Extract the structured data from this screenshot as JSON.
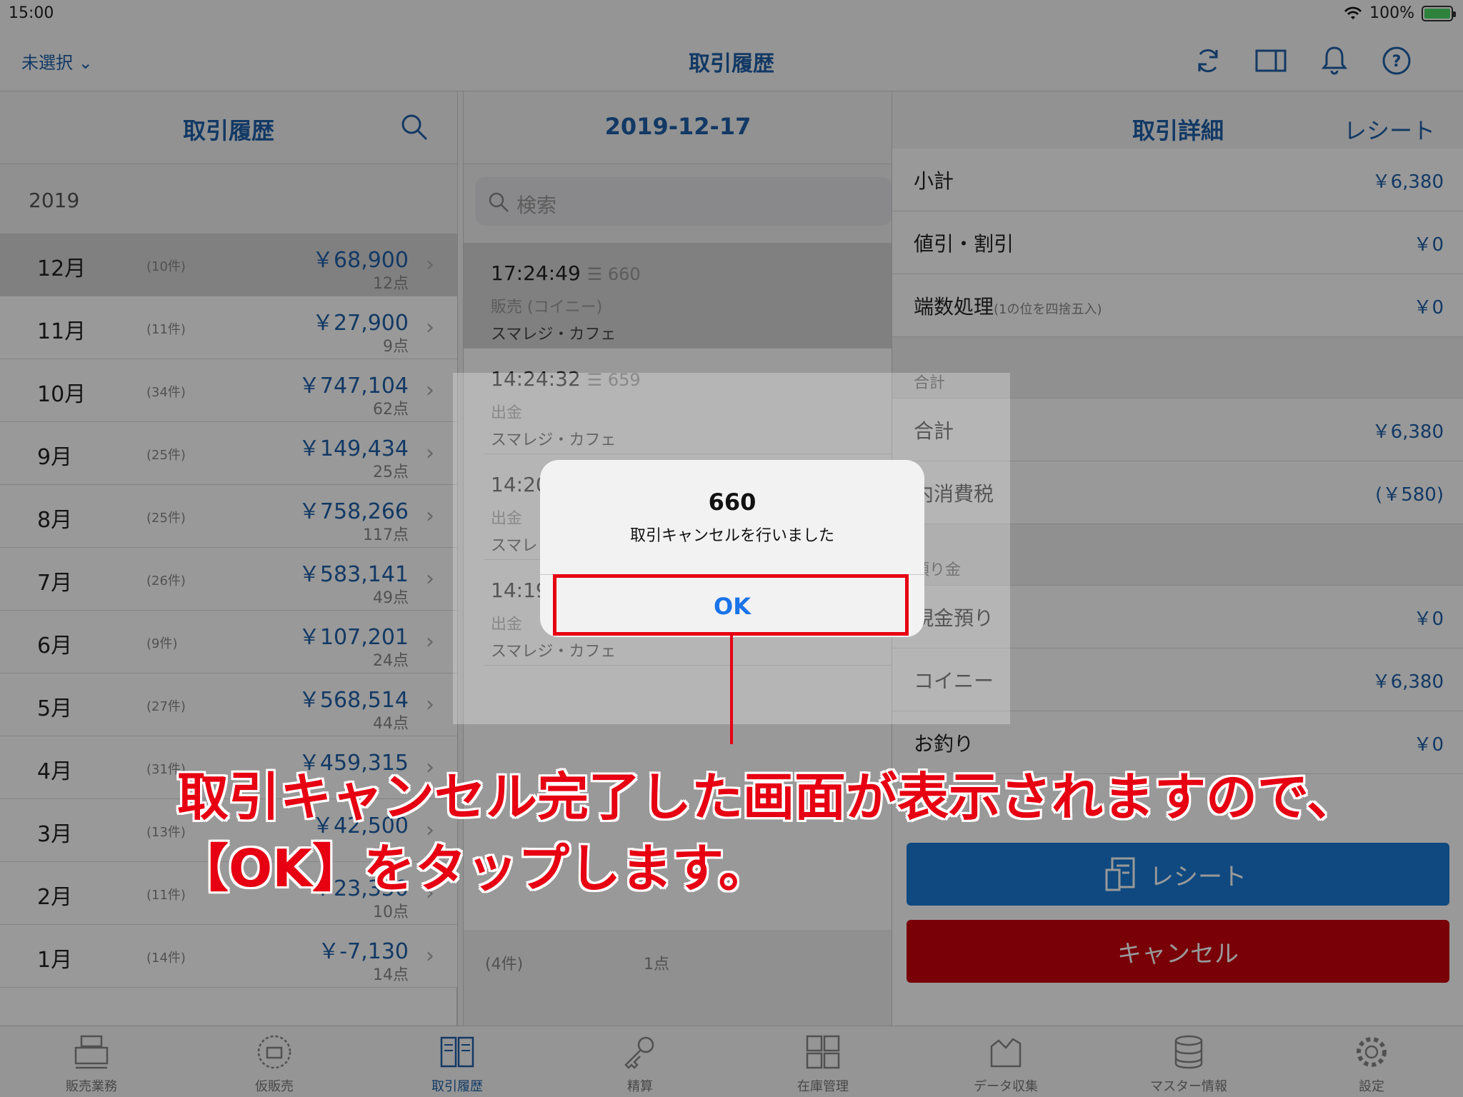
{
  "status_bar": {
    "time": "15:00",
    "battery": "100%"
  },
  "nav": {
    "store_selector": "未選択",
    "title": "取引履歴"
  },
  "left_panel": {
    "title": "取引履歴",
    "year": "2019",
    "months": [
      {
        "month": "12月",
        "count": "(10件)",
        "amount": "￥68,900",
        "points": "12点",
        "selected": true
      },
      {
        "month": "11月",
        "count": "(11件)",
        "amount": "￥27,900",
        "points": "9点"
      },
      {
        "month": "10月",
        "count": "(34件)",
        "amount": "￥747,104",
        "points": "62点"
      },
      {
        "month": "9月",
        "count": "(25件)",
        "amount": "￥149,434",
        "points": "25点"
      },
      {
        "month": "8月",
        "count": "(25件)",
        "amount": "￥758,266",
        "points": "117点"
      },
      {
        "month": "7月",
        "count": "(26件)",
        "amount": "￥583,141",
        "points": "49点"
      },
      {
        "month": "6月",
        "count": "(9件)",
        "amount": "￥107,201",
        "points": "24点"
      },
      {
        "month": "5月",
        "count": "(27件)",
        "amount": "￥568,514",
        "points": "44点"
      },
      {
        "month": "4月",
        "count": "(31件)",
        "amount": "￥459,315",
        "points": ""
      },
      {
        "month": "3月",
        "count": "(13件)",
        "amount": "￥42,500",
        "points": ""
      },
      {
        "month": "2月",
        "count": "(11件)",
        "amount": "￥23,350",
        "points": "10点"
      },
      {
        "month": "1月",
        "count": "(14件)",
        "amount": "￥-7,130",
        "points": "14点"
      }
    ]
  },
  "middle_panel": {
    "date": "2019-12-17",
    "search_placeholder": "検索",
    "transactions": [
      {
        "time": "17:24:49",
        "number": "☰ 660",
        "type": "販売 (コイニー)",
        "shop": "スマレジ・カフェ",
        "selected": true
      },
      {
        "time": "14:24:32",
        "number": "☰ 659",
        "type": "出金",
        "shop": "スマレジ・カフェ"
      },
      {
        "time": "14:20",
        "number": "",
        "type": "出金",
        "shop": "スマレ"
      },
      {
        "time": "14:19",
        "number": "",
        "type": "出金",
        "shop": "スマレジ・カフェ"
      }
    ],
    "footer_count": "(4件)",
    "footer_points": "1点"
  },
  "right_panel": {
    "title": "取引詳細",
    "receipt_link": "レシート",
    "rows": [
      {
        "label": "小計",
        "note": "",
        "value": "￥6,380"
      },
      {
        "label": "値引・割引",
        "note": "",
        "value": "￥0"
      },
      {
        "label": "端数処理",
        "note": "(1の位を四捨五入)",
        "value": "￥0"
      }
    ],
    "section_total": "合計",
    "total_rows": [
      {
        "label": "合計",
        "value": "￥6,380"
      },
      {
        "label": "内消費税",
        "value": "(￥580)"
      }
    ],
    "section_deposit": "預り金",
    "deposit_rows": [
      {
        "label": "現金預り",
        "value": "￥0"
      },
      {
        "label": "コイニー",
        "value": "￥6,380"
      },
      {
        "label": "お釣り",
        "value": "￥0"
      }
    ],
    "receipt_button": "レシート",
    "cancel_button": "キャンセル"
  },
  "tabs": [
    {
      "label": "販売業務",
      "icon": "register-icon"
    },
    {
      "label": "仮販売",
      "icon": "temp-sale-icon"
    },
    {
      "label": "取引履歴",
      "icon": "history-book-icon",
      "active": true
    },
    {
      "label": "精算",
      "icon": "key-icon"
    },
    {
      "label": "在庫管理",
      "icon": "inventory-icon"
    },
    {
      "label": "データ収集",
      "icon": "data-collection-icon"
    },
    {
      "label": "マスター情報",
      "icon": "database-icon"
    },
    {
      "label": "設定",
      "icon": "gear-icon"
    }
  ],
  "alert": {
    "title": "660",
    "message": "取引キャンセルを行いました",
    "ok": "OK"
  },
  "annotation": {
    "line1": "取引キャンセル完了した画面が表示されますので、",
    "line2": "【OK】をタップします。"
  },
  "colors": {
    "accent": "#1f5fa8",
    "annotation_red": "#e60012",
    "receipt_btn": "#1a7ad6",
    "cancel_btn": "#c8000a"
  }
}
